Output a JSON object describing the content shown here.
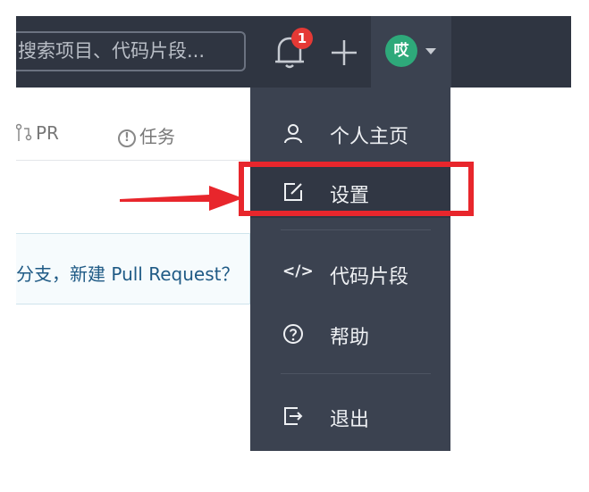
{
  "header": {
    "search_placeholder": "搜索项目、代码片段...",
    "notification_count": "1",
    "avatar_text": "哎"
  },
  "tabs": {
    "pr_label": "PR",
    "issues_label": "任务",
    "issues_icon_glyph": "!"
  },
  "banner": {
    "text": "分支，新建 Pull Request？"
  },
  "menu": {
    "items": [
      {
        "label": "个人主页",
        "icon": "user-icon"
      },
      {
        "label": "设置",
        "icon": "edit-icon"
      },
      {
        "label": "代码片段",
        "icon": "code-icon",
        "glyph": "</>"
      },
      {
        "label": "帮助",
        "icon": "help-icon"
      },
      {
        "label": "退出",
        "icon": "logout-icon"
      }
    ]
  },
  "colors": {
    "topbar": "#2f3541",
    "menu": "#3b4250",
    "avatar": "#2ea97a",
    "highlight": "#e8262c"
  }
}
